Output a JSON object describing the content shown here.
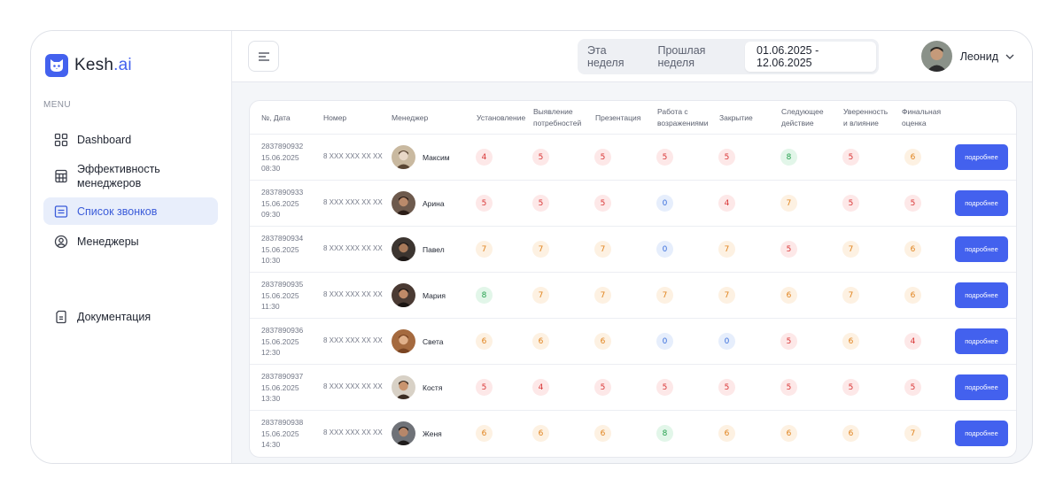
{
  "brand": {
    "name": "Kesh",
    "suffix": ".ai"
  },
  "sidebar": {
    "menu_label": "MENU",
    "items": [
      {
        "label": "Dashboard",
        "icon": "grid-icon",
        "active": false
      },
      {
        "label": "Эффективность менеджеров",
        "icon": "calculator-icon",
        "active": false
      },
      {
        "label": "Список звонков",
        "icon": "list-icon",
        "active": true
      },
      {
        "label": "Менеджеры",
        "icon": "user-circle-icon",
        "active": false
      }
    ],
    "docs": {
      "label": "Документация",
      "icon": "document-icon"
    }
  },
  "topbar": {
    "period_options": [
      "Эта неделя",
      "Прошлая неделя"
    ],
    "date_range": "01.06.2025 - 12.06.2025",
    "user_name": "Леонид"
  },
  "table": {
    "headers": [
      "№, Дата",
      "Номер",
      "Менеджер",
      "Установление",
      "Выявление потребностей",
      "Презентация",
      "Работа с возражениями",
      "Закрытие",
      "Следующее действие",
      "Уверенность и влияние",
      "Финальная оценка"
    ],
    "button_label": "подробнее",
    "rows": [
      {
        "id": "2837890932",
        "date": "15.06.2025",
        "time": "08:30",
        "phone": "8 XXX XXX XX XX",
        "manager": "Максим",
        "scores": [
          "4",
          "5",
          "5",
          "5",
          "5",
          "8",
          "5",
          "6"
        ]
      },
      {
        "id": "2837890933",
        "date": "15.06.2025",
        "time": "09:30",
        "phone": "8 XXX XXX XX XX",
        "manager": "Арина",
        "scores": [
          "5",
          "5",
          "5",
          "0",
          "4",
          "7",
          "5",
          "5"
        ]
      },
      {
        "id": "2837890934",
        "date": "15.06.2025",
        "time": "10:30",
        "phone": "8 XXX XXX XX XX",
        "manager": "Павел",
        "scores": [
          "7",
          "7",
          "7",
          "0",
          "7",
          "5",
          "7",
          "6"
        ]
      },
      {
        "id": "2837890935",
        "date": "15.06.2025",
        "time": "11:30",
        "phone": "8 XXX XXX XX XX",
        "manager": "Мария",
        "scores": [
          "8",
          "7",
          "7",
          "7",
          "7",
          "6",
          "7",
          "6"
        ]
      },
      {
        "id": "2837890936",
        "date": "15.06.2025",
        "time": "12:30",
        "phone": "8 XXX XXX XX XX",
        "manager": "Света",
        "scores": [
          "6",
          "6",
          "6",
          "0",
          "0",
          "5",
          "6",
          "4"
        ]
      },
      {
        "id": "2837890937",
        "date": "15.06.2025",
        "time": "13:30",
        "phone": "8 XXX XXX XX XX",
        "manager": "Костя",
        "scores": [
          "5",
          "4",
          "5",
          "5",
          "5",
          "5",
          "5",
          "5"
        ]
      },
      {
        "id": "2837890938",
        "date": "15.06.2025",
        "time": "14:30",
        "phone": "8 XXX XXX XX XX",
        "manager": "Женя",
        "scores": [
          "6",
          "6",
          "6",
          "8",
          "6",
          "6",
          "6",
          "7"
        ]
      }
    ]
  },
  "colors": {
    "accent": "#4361ee",
    "score_red": "#d93636",
    "score_orange": "#e0821c",
    "score_green": "#24a04d",
    "score_blue": "#3b6fdc"
  }
}
